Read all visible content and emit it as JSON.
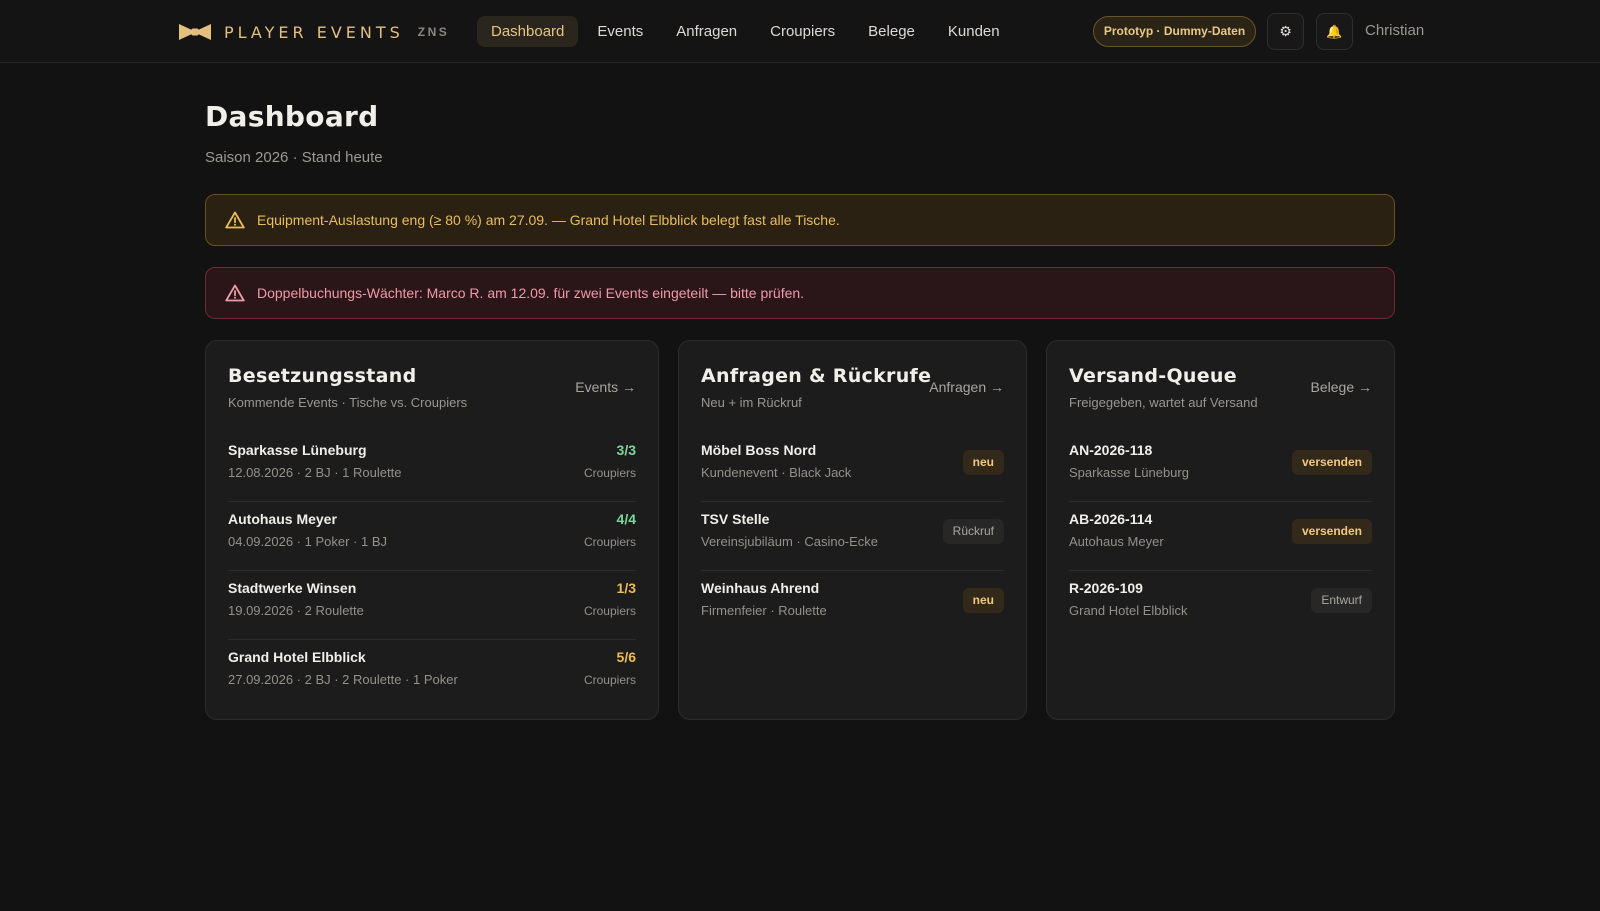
{
  "brand": {
    "name": "PLAYER EVENTS",
    "sub": "ZNS"
  },
  "nav": [
    "Dashboard",
    "Events",
    "Anfragen",
    "Croupiers",
    "Belege",
    "Kunden"
  ],
  "header": {
    "badge": "Prototyp · Dummy-Daten",
    "settings_icon": "⚙",
    "bell_icon": "🔔",
    "user": "Christian"
  },
  "page": {
    "title": "Dashboard",
    "subtitle": "Saison 2026 · Stand heute"
  },
  "alerts": {
    "warning": "Equipment-Auslastung eng (≥ 80 %) am 27.09. — Grand Hotel Elbblick belegt fast alle Tische.",
    "danger": "Doppelbuchungs-Wächter: Marco R. am 12.09. für zwei Events eingeteilt — bitte prüfen."
  },
  "colors": {
    "accent": "#e6c584",
    "ok": "#7ed69b",
    "warn": "#ecbb52",
    "danger": "#ef9aa6"
  },
  "besetzung": {
    "title": "Besetzungsstand",
    "subtitle": "Kommende Events · Tische vs. Croupiers",
    "link": "Events →",
    "rows": [
      {
        "title": "Sparkasse Lüneburg",
        "meta": "12.08.2026 · 2 BJ · 1 Roulette",
        "count": "3/3",
        "unit": "Croupiers",
        "status": "ok"
      },
      {
        "title": "Autohaus Meyer",
        "meta": "04.09.2026 · 1 Poker · 1 BJ",
        "count": "4/4",
        "unit": "Croupiers",
        "status": "ok"
      },
      {
        "title": "Stadtwerke Winsen",
        "meta": "19.09.2026 · 2 Roulette",
        "count": "1/3",
        "unit": "Croupiers",
        "status": "warn"
      },
      {
        "title": "Grand Hotel Elbblick",
        "meta": "27.09.2026 · 2 BJ · 2 Roulette · 1 Poker",
        "count": "5/6",
        "unit": "Croupiers",
        "status": "warn"
      }
    ]
  },
  "anfragen": {
    "title": "Anfragen & Rückrufe",
    "subtitle": "Neu + im Rückruf",
    "link": "Anfragen →",
    "rows": [
      {
        "title": "Möbel Boss Nord",
        "meta": "Kundenevent · Black Jack",
        "tag": "neu",
        "tag_style": "tag-neu"
      },
      {
        "title": "TSV Stelle",
        "meta": "Vereinsjubiläum · Casino-Ecke",
        "tag": "Rückruf",
        "tag_style": "tag-grey"
      },
      {
        "title": "Weinhaus Ahrend",
        "meta": "Firmenfeier · Roulette",
        "tag": "neu",
        "tag_style": "tag-neu"
      }
    ]
  },
  "versand": {
    "title": "Versand-Queue",
    "subtitle": "Freigegeben, wartet auf Versand",
    "link": "Belege →",
    "rows": [
      {
        "title": "AN-2026-118",
        "meta": "Sparkasse Lüneburg",
        "tag": "versenden",
        "tag_style": "tag-versenden"
      },
      {
        "title": "AB-2026-114",
        "meta": "Autohaus Meyer",
        "tag": "versenden",
        "tag_style": "tag-versenden"
      },
      {
        "title": "R-2026-109",
        "meta": "Grand Hotel Elbblick",
        "tag": "Entwurf",
        "tag_style": "tag-grey"
      }
    ]
  }
}
